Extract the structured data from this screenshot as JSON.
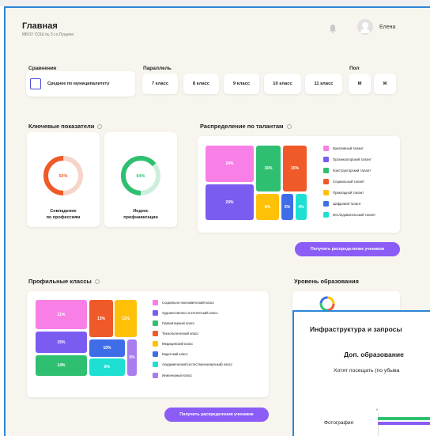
{
  "header": {
    "title": "Главная",
    "subtitle": "МБОУ СОШ № 3 г.о.Пущино",
    "username": "Елена"
  },
  "filters": {
    "comparison_label": "Сравнение",
    "comparison_option": "Среднее по муниципалитету",
    "parallel_label": "Параллель",
    "grades": [
      "7 класс",
      "8 класс",
      "9 класс",
      "10 класс",
      "11 класс"
    ],
    "gender_label": "Пол",
    "genders": [
      "М",
      "Ж"
    ]
  },
  "key_indicators": {
    "title": "Ключевые показатели",
    "items": [
      {
        "label1": "Совпадение",
        "label2": "по профессиям",
        "value": 50,
        "value_text": "50%",
        "color": "#f05a28"
      },
      {
        "label1": "Индекс",
        "label2": "профнавигации",
        "value": 64,
        "value_text": "64%",
        "color": "#2fbf71"
      }
    ]
  },
  "talents": {
    "title": "Распределение по талантам",
    "button": "Получить распределение учеников",
    "chart_data": {
      "type": "treemap",
      "series": [
        {
          "name": "Креативный талант",
          "value": 24,
          "label": "24%",
          "color": "#f77fe6"
        },
        {
          "name": "Организаторский талант",
          "value": 24,
          "label": "24%",
          "color": "#7b5cf0"
        },
        {
          "name": "Конструкторский талант",
          "value": 16,
          "label": "16%",
          "color": "#2fbf71"
        },
        {
          "name": "Социальный талант",
          "value": 15,
          "label": "15%",
          "color": "#f05a28"
        },
        {
          "name": "Прикладной талант",
          "value": 8,
          "label": "8%",
          "color": "#ffc107"
        },
        {
          "name": "Цифровой талант",
          "value": 5,
          "label": "5%",
          "color": "#3f6de8"
        },
        {
          "name": "Исследовательский талант",
          "value": 4,
          "label": "4%",
          "color": "#1de0d2"
        }
      ]
    }
  },
  "profile_classes": {
    "title": "Профильные классы",
    "button": "Получить распределения учеников",
    "chart_data": {
      "type": "treemap",
      "series": [
        {
          "name": "Социально-экономический класс",
          "value": 21,
          "label": "21%",
          "color": "#f77fe6"
        },
        {
          "name": "Художественно-эстетический класс",
          "value": 15,
          "label": "15%",
          "color": "#7b5cf0"
        },
        {
          "name": "Гуманитарный класс",
          "value": 14,
          "label": "14%",
          "color": "#2fbf71"
        },
        {
          "name": "Технологический класс",
          "value": 13,
          "label": "13%",
          "color": "#f05a28"
        },
        {
          "name": "Медицинский класс",
          "value": 11,
          "label": "11%",
          "color": "#ffc107"
        },
        {
          "name": "Кадетский класс",
          "value": 10,
          "label": "10%",
          "color": "#3f6de8"
        },
        {
          "name": "Академический (естественнонаучный) класс",
          "value": 8,
          "label": "8%",
          "color": "#1de0d2"
        },
        {
          "name": "Инженерный класс",
          "value": 5,
          "label": "5%",
          "color": "#a97cf0"
        }
      ]
    }
  },
  "education_level": {
    "title": "Уровень образования"
  },
  "popup": {
    "title": "Инфраструктура и запросы",
    "subtitle": "Доп. образование",
    "question": "Хотят посещать (по убыва",
    "axis_tick": "0",
    "row_label": "Фотография"
  }
}
